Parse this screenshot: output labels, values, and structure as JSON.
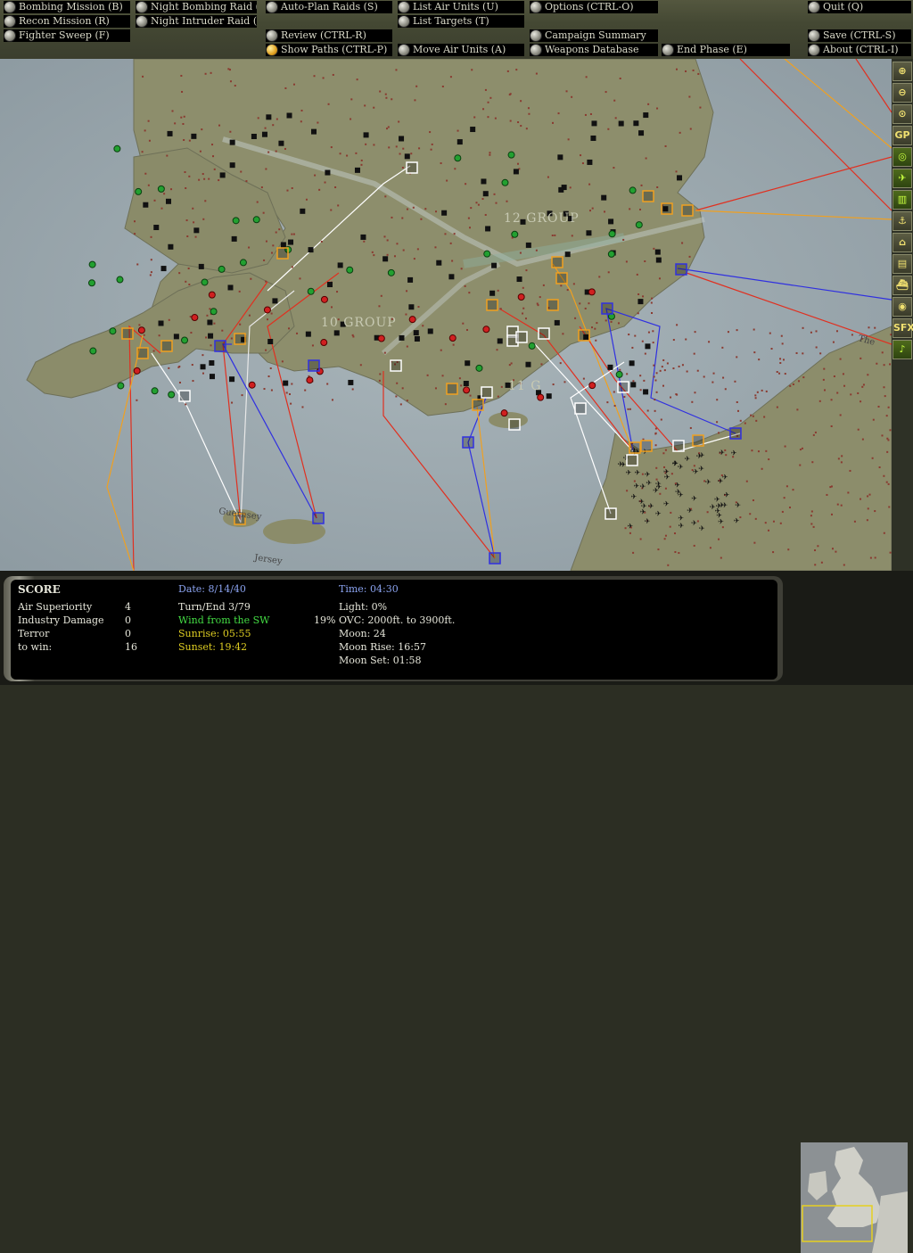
{
  "menu": {
    "bombing_mission": "Bombing Mission (B)",
    "recon_mission": "Recon Mission (R)",
    "fighter_sweep": "Fighter Sweep (F)",
    "night_bombing": "Night Bombing Raid (N)",
    "night_intruder": "Night Intruder Raid (I)",
    "auto_plan": "Auto-Plan Raids (S)",
    "review": "Review (CTRL-R)",
    "show_paths": "Show Paths (CTRL-P)",
    "list_air_units": "List Air Units (U)",
    "list_targets": "List Targets (T)",
    "move_air_units": "Move Air Units (A)",
    "options": "Options (CTRL-O)",
    "campaign_summary": "Campaign Summary",
    "weapons_database": "Weapons Database",
    "end_phase": "End Phase (E)",
    "quit": "Quit (Q)",
    "save": "Save (CTRL-S)",
    "about": "About (CTRL-I)"
  },
  "map": {
    "labels": {
      "group12": "12 GROUP",
      "group10": "10 GROUP",
      "group11": "11 G",
      "guernsey": "Guernsey",
      "jersey": "Jersey",
      "the": "The"
    }
  },
  "toolbar": {
    "gp": "GP",
    "sfx": "SFX",
    "icons": [
      "zoom-in-icon",
      "zoom-out-icon",
      "center-icon",
      "gp-icon",
      "radar-icon",
      "aircraft-icon",
      "factory-icon",
      "anchor-icon",
      "airfield-icon",
      "building-icon",
      "ship-icon",
      "target-icon",
      "sfx-icon",
      "music-icon"
    ]
  },
  "score": {
    "heading": "SCORE",
    "rows": [
      {
        "label": "Air Superiority",
        "value": "4"
      },
      {
        "label": "Industry Damage",
        "value": "0"
      },
      {
        "label": "Terror",
        "value": "0"
      },
      {
        "label": "to win:",
        "value": "16"
      }
    ],
    "date": "Date: 8/14/40",
    "turn": "Turn/End  3/79",
    "wind": "Wind from the SW",
    "sunrise": "Sunrise: 05:55",
    "sunset": "Sunset: 19:42",
    "time": "Time: 04:30",
    "light": "Light: 0%",
    "cloud": "19% OVC: 2000ft. to 3900ft.",
    "moon": "Moon: 24",
    "moonrise": "Moon Rise: 16:57",
    "moonset": "Moon Set: 01:58"
  },
  "colors": {
    "menu_bg": "#000000",
    "menu_text": "#d9d9c8",
    "blue_text": "#8aa2ee",
    "green_text": "#44dd44",
    "yellow_text": "#ddcc22",
    "sea": "#9aa7ad",
    "land": "#8b8c6a"
  }
}
